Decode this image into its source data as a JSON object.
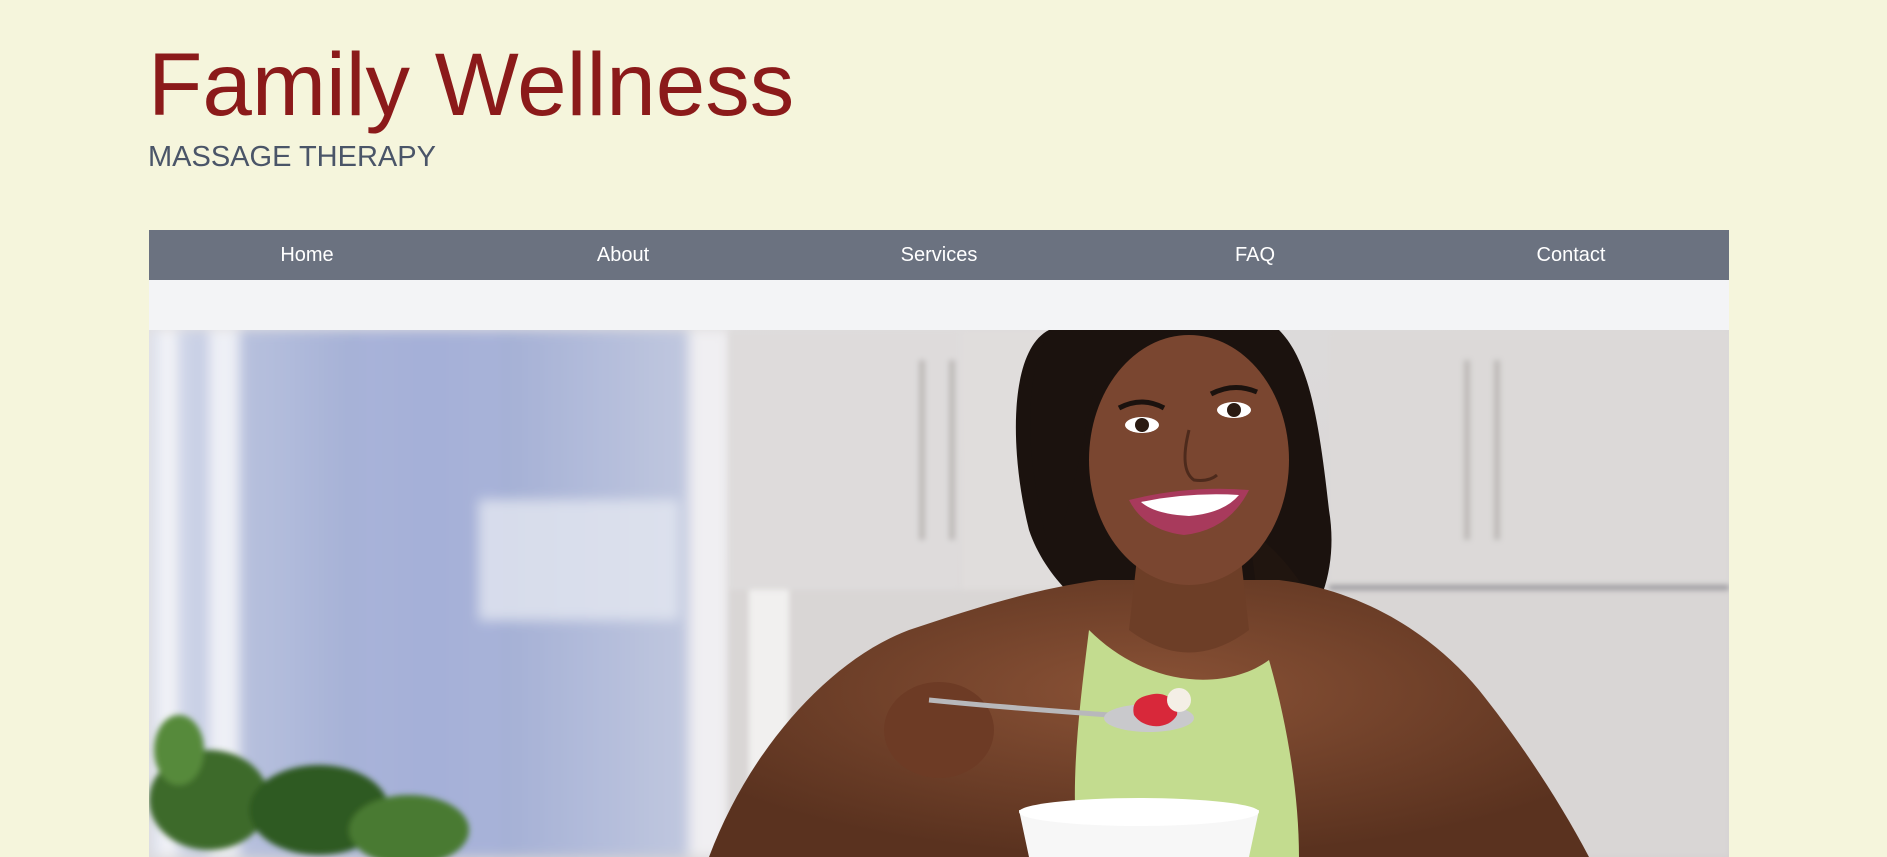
{
  "header": {
    "title": "Family Wellness",
    "tagline": "MASSAGE THERAPY"
  },
  "nav": {
    "items": [
      {
        "label": "Home"
      },
      {
        "label": "About"
      },
      {
        "label": "Services"
      },
      {
        "label": "FAQ"
      },
      {
        "label": "Contact"
      }
    ]
  },
  "colors": {
    "page_background": "#f5f5dc",
    "title": "#8b1a1a",
    "tagline": "#4a5568",
    "nav_background": "#6b7280",
    "nav_text": "#ffffff",
    "subbar_background": "#f3f4f6"
  },
  "hero": {
    "image": "woman-eating-strawberry-photo"
  }
}
